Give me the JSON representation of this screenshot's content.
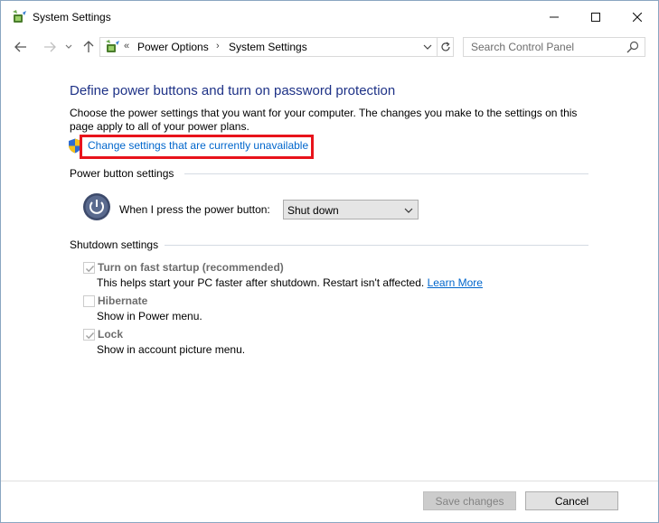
{
  "window": {
    "title": "System Settings",
    "icon": "power-options-icon"
  },
  "address_bar": {
    "prefix": "«",
    "crumbs": [
      "Power Options",
      "System Settings"
    ],
    "separator": "›"
  },
  "search": {
    "placeholder": "Search Control Panel"
  },
  "main": {
    "heading": "Define power buttons and turn on password protection",
    "description": "Choose the power settings that you want for your computer. The changes you make to the settings on this page apply to all of your power plans.",
    "uac_link": "Change settings that are currently unavailable",
    "power_button_section": {
      "label": "Power button settings",
      "prompt": "When I press the power button:",
      "selected": "Shut down"
    },
    "shutdown_section": {
      "label": "Shutdown settings",
      "options": [
        {
          "label": "Turn on fast startup (recommended)",
          "checked": true,
          "desc": "This helps start your PC faster after shutdown. Restart isn't affected.",
          "link": "Learn More"
        },
        {
          "label": "Hibernate",
          "checked": false,
          "desc": "Show in Power menu."
        },
        {
          "label": "Lock",
          "checked": true,
          "desc": "Show in account picture menu."
        }
      ]
    }
  },
  "footer": {
    "save_label": "Save changes",
    "cancel_label": "Cancel"
  },
  "colors": {
    "heading": "#1e3287",
    "link": "#0066cc",
    "highlight": "#e8131b"
  }
}
